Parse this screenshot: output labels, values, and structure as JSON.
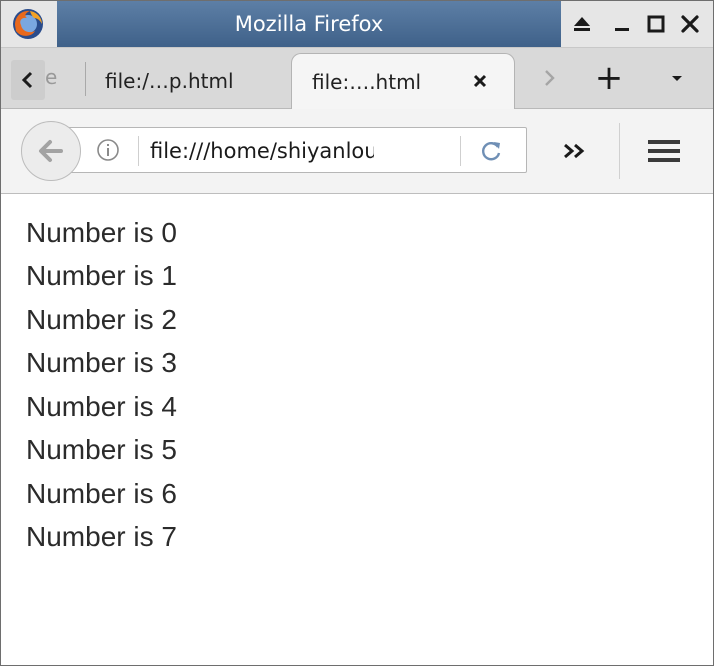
{
  "window": {
    "title": "Mozilla Firefox"
  },
  "tabs": [
    {
      "label": "file:/…p.html",
      "active": false
    },
    {
      "label": "file:….html",
      "active": true
    }
  ],
  "tab_strip": {
    "partial_tab_label": "e",
    "new_tab_symbol": "+"
  },
  "navbar": {
    "url": "file:///home/shiyanlou"
  },
  "content": {
    "lines": [
      "Number is 0",
      "Number is 1",
      "Number is 2",
      "Number is 3",
      "Number is 4",
      "Number is 5",
      "Number is 6",
      "Number is 7"
    ]
  },
  "colors": {
    "titlebar_accent": "#4a6d96",
    "content_text": "#2b2b2b",
    "toolbar_bg": "#f3f3f3"
  }
}
